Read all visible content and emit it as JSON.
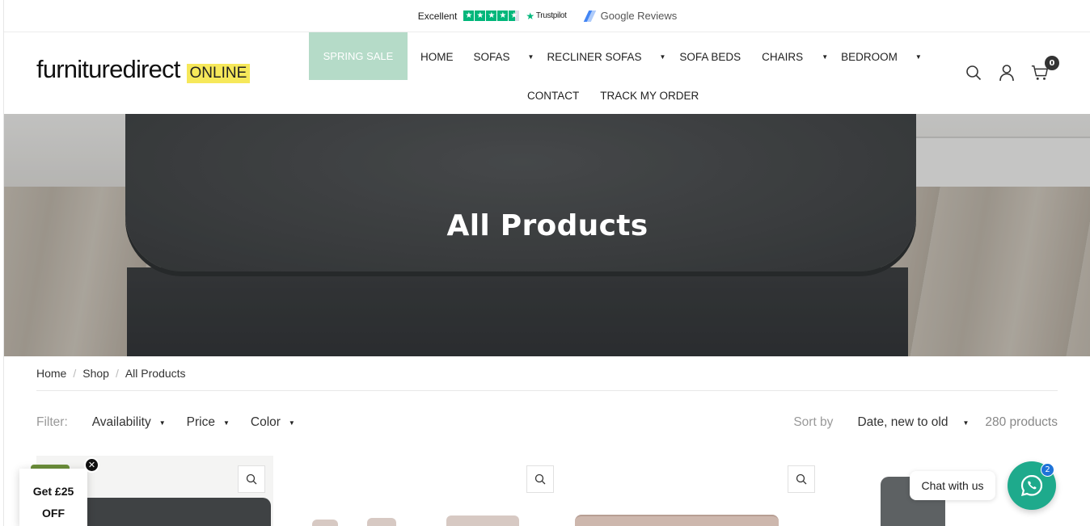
{
  "topbar": {
    "trustpilot_rating": "Excellent",
    "trustpilot_brand": "Trustpilot",
    "google_reviews": "Google Reviews"
  },
  "header": {
    "logo_text": "furnituredirect",
    "logo_badge": "ONLINE",
    "promo_label": "SPRING SALE",
    "nav": [
      {
        "label": "HOME"
      },
      {
        "label": "SOFAS"
      },
      {
        "label": "RECLINER SOFAS"
      },
      {
        "label": "SOFA BEDS"
      },
      {
        "label": "CHAIRS"
      },
      {
        "label": "BEDROOM"
      }
    ],
    "nav_row2": [
      {
        "label": "CONTACT"
      },
      {
        "label": "TRACK MY ORDER"
      }
    ],
    "cart_count": "0"
  },
  "hero": {
    "title": "All Products"
  },
  "breadcrumb": [
    "Home",
    "Shop",
    "All Products"
  ],
  "filters": {
    "label": "Filter:",
    "items": [
      "Availability",
      "Price",
      "Color"
    ],
    "sort_label": "Sort by",
    "sort_value": "Date, new to old",
    "product_count": "280 products"
  },
  "coupon": {
    "line1": "Get £25",
    "line2": "OFF"
  },
  "chat": {
    "label": "Chat with us",
    "badge": "2"
  },
  "colors": {
    "promo_bg": "#b5dbc8",
    "logo_badge_bg": "#f6e85a",
    "chat_green": "#1eaa8c",
    "trustpilot_green": "#00b67a"
  }
}
